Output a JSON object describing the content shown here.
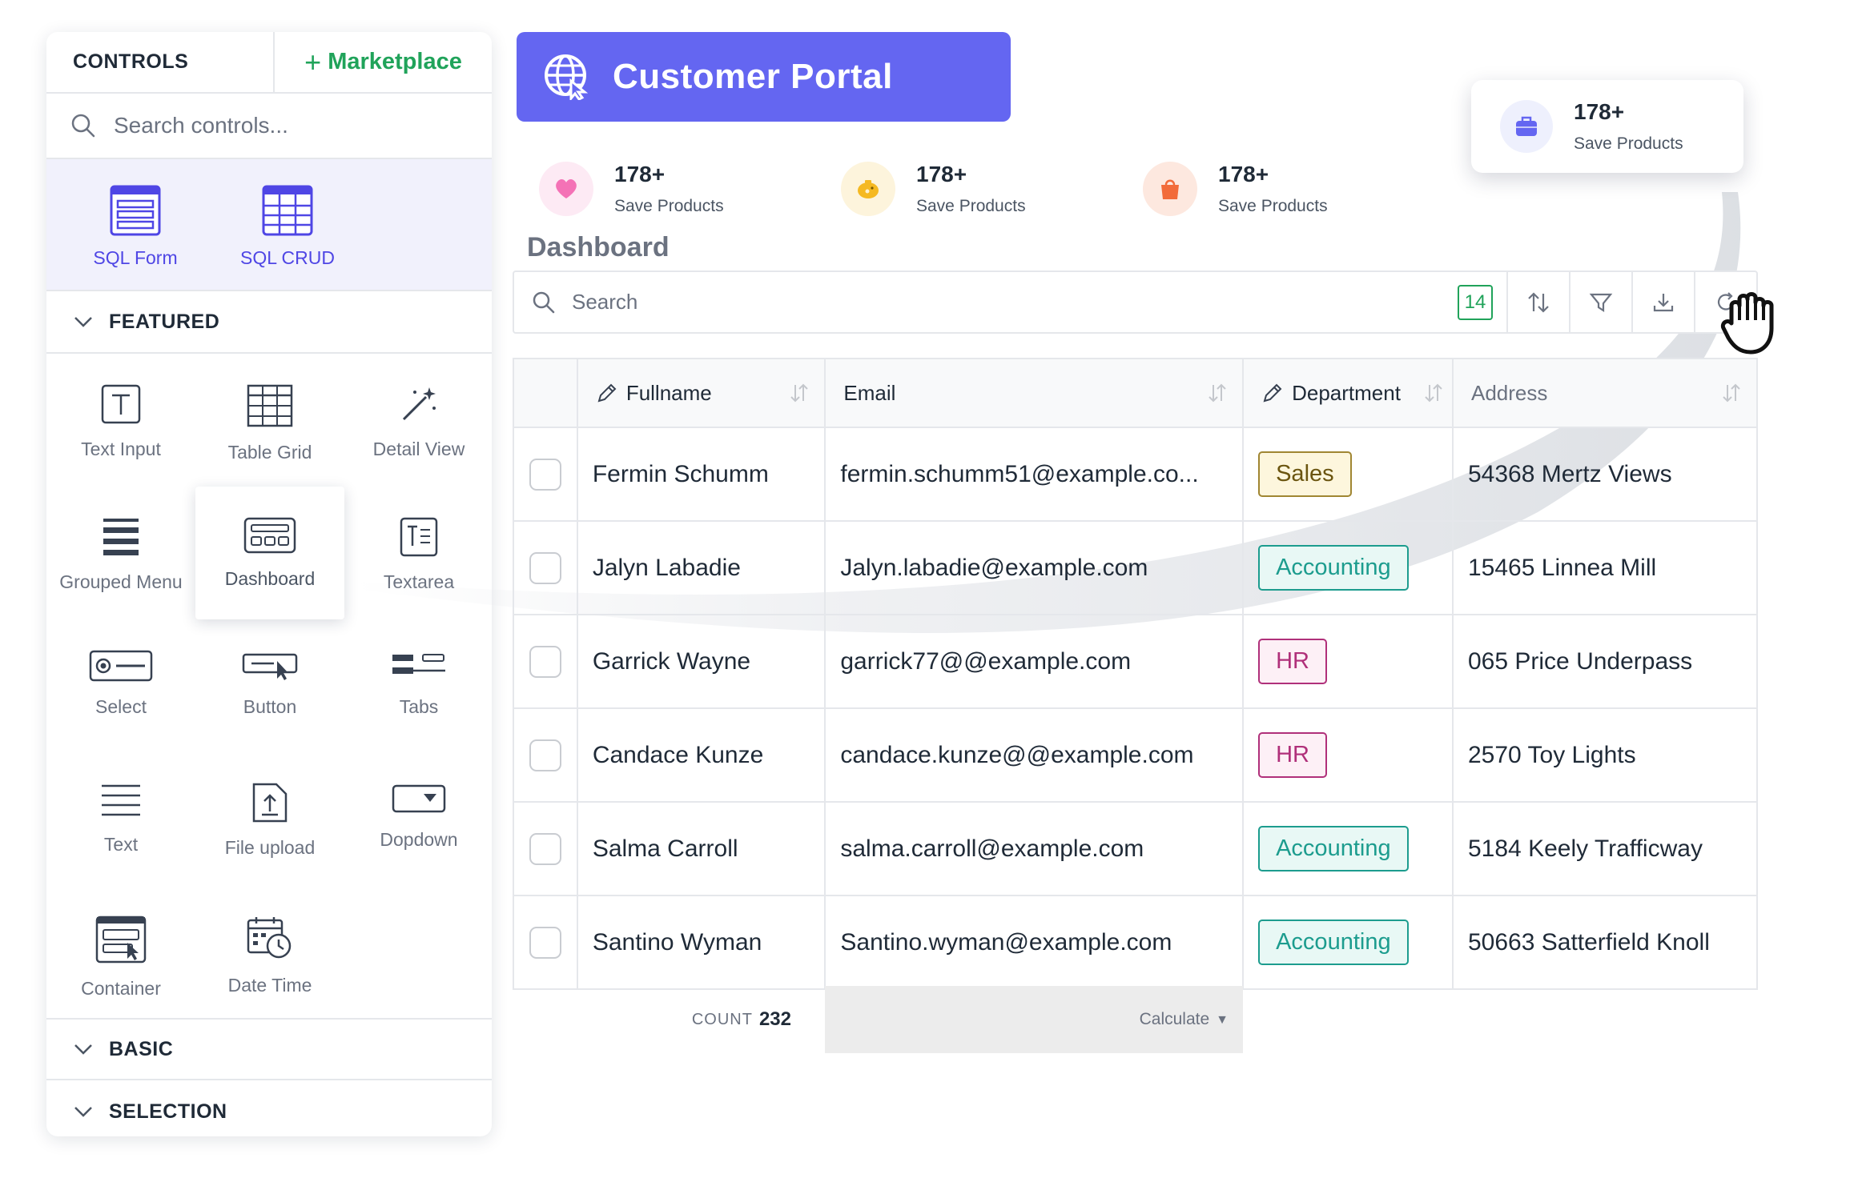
{
  "sidebar": {
    "tab_controls": "CONTROLS",
    "tab_marketplace": "Marketplace",
    "search_placeholder": "Search controls...",
    "sql_items": [
      {
        "label": "SQL Form",
        "icon": "sql-form-icon"
      },
      {
        "label": "SQL CRUD",
        "icon": "sql-crud-icon"
      }
    ],
    "featured_label": "FEATURED",
    "featured_items": [
      {
        "label": "Text Input",
        "icon": "text-input-icon"
      },
      {
        "label": "Table Grid",
        "icon": "table-grid-icon"
      },
      {
        "label": "Detail View",
        "icon": "magic-wand-icon"
      },
      {
        "label": "Grouped Menu",
        "icon": "grouped-menu-icon"
      },
      {
        "label": "Dashboard",
        "icon": "dashboard-icon"
      },
      {
        "label": "Textarea",
        "icon": "textarea-icon"
      },
      {
        "label": "Select",
        "icon": "select-icon"
      },
      {
        "label": "Button",
        "icon": "button-icon"
      },
      {
        "label": "Tabs",
        "icon": "tabs-icon"
      },
      {
        "label": "Text",
        "icon": "text-lines-icon"
      },
      {
        "label": "File upload",
        "icon": "file-upload-icon"
      },
      {
        "label": "Dopdown",
        "icon": "dropdown-icon"
      },
      {
        "label": "Container",
        "icon": "container-icon"
      },
      {
        "label": "Date Time",
        "icon": "date-time-icon"
      }
    ],
    "basic_label": "BASIC",
    "selection_label": "SELECTION"
  },
  "header": {
    "title": "Customer Portal",
    "accent": "#6466f1"
  },
  "stats": [
    {
      "value": "178+",
      "label": "Save Products",
      "icon": "heart-icon",
      "color": "#f472b6"
    },
    {
      "value": "178+",
      "label": "Save Products",
      "icon": "piggy-bank-icon",
      "color": "#f5b922"
    },
    {
      "value": "178+",
      "label": "Save Products",
      "icon": "shopping-bag-icon",
      "color": "#f26b3a"
    }
  ],
  "floating_stat": {
    "value": "178+",
    "label": "Save Products",
    "icon": "briefcase-icon"
  },
  "dashboard": {
    "title": "Dashboard",
    "search_placeholder": "Search",
    "badge_count": "14",
    "columns": [
      "Fullname",
      "Email",
      "Department",
      "Address"
    ],
    "rows": [
      {
        "name": "Fermin Schumm",
        "email": "fermin.schumm51@example.co...",
        "dept": "Sales",
        "address": "54368 Mertz Views"
      },
      {
        "name": "Jalyn Labadie",
        "email": "Jalyn.labadie@example.com",
        "dept": "Accounting",
        "address": "15465 Linnea Mill"
      },
      {
        "name": "Garrick Wayne",
        "email": "garrick77@@example.com",
        "dept": "HR",
        "address": "065 Price Underpass"
      },
      {
        "name": "Candace Kunze",
        "email": "candace.kunze@@example.com",
        "dept": "HR",
        "address": "2570 Toy Lights"
      },
      {
        "name": "Salma Carroll",
        "email": "salma.carroll@example.com",
        "dept": "Accounting",
        "address": "5184 Keely Trafficway"
      },
      {
        "name": "Santino Wyman",
        "email": "Santino.wyman@example.com",
        "dept": "Accounting",
        "address": "50663 Satterfield Knoll"
      }
    ],
    "count_label": "COUNT",
    "count_value": "232",
    "calculate_label": "Calculate"
  }
}
